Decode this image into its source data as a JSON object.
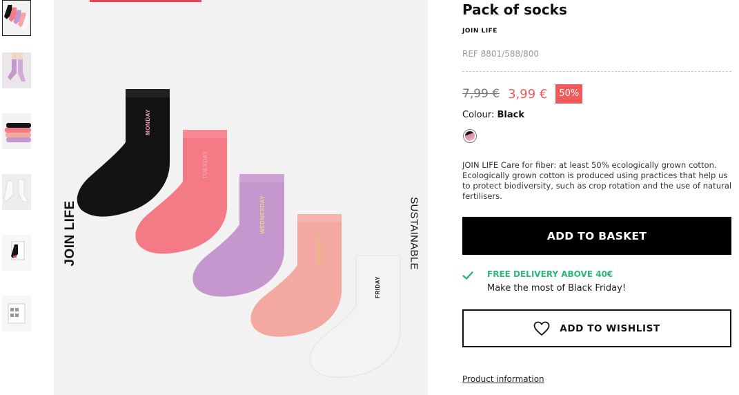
{
  "product": {
    "title": "Pack of socks",
    "brand": "JOIN LIFE",
    "ref": "REF 8801/588/800",
    "old_price": "7,99 €",
    "new_price": "3,99 €",
    "discount": "50%",
    "colour_label": "Colour:",
    "colour_value": "Black",
    "description": "JOIN LIFE Care for fiber: at least 50% ecologically grown cotton. Ecologically grown cotton is produced using practices that help us to protect biodiversity, such as crop rotation and the use of natural fertilisers."
  },
  "image": {
    "left_text": "JOIN LIFE",
    "right_text": "SUSTAINABLE",
    "sock_labels": [
      "MONDAY",
      "TUESDAY",
      "WEDNESDAY",
      "THURSDAY",
      "FRIDAY"
    ]
  },
  "thumbnails": [
    "socks-fan",
    "model-purple-socks",
    "socks-stack",
    "model-white-socks",
    "socks-black-pack",
    "label-card"
  ],
  "actions": {
    "add_to_basket": "ADD TO BASKET",
    "add_to_wishlist": "ADD TO WISHLIST",
    "product_information": "Product information"
  },
  "delivery": {
    "title": "FREE DELIVERY ABOVE 40€",
    "subtitle": "Make the most of Black Friday!"
  },
  "colors": {
    "sale_red": "#f05a5a",
    "delivery_green": "#2fb67a",
    "progress_accent": "#e8445a",
    "sock_colors": [
      "#131313",
      "#f47a86",
      "#c697cf",
      "#f4a8a2",
      "#f2f1f2"
    ]
  },
  "icons": [
    "check-icon",
    "heart-icon"
  ]
}
